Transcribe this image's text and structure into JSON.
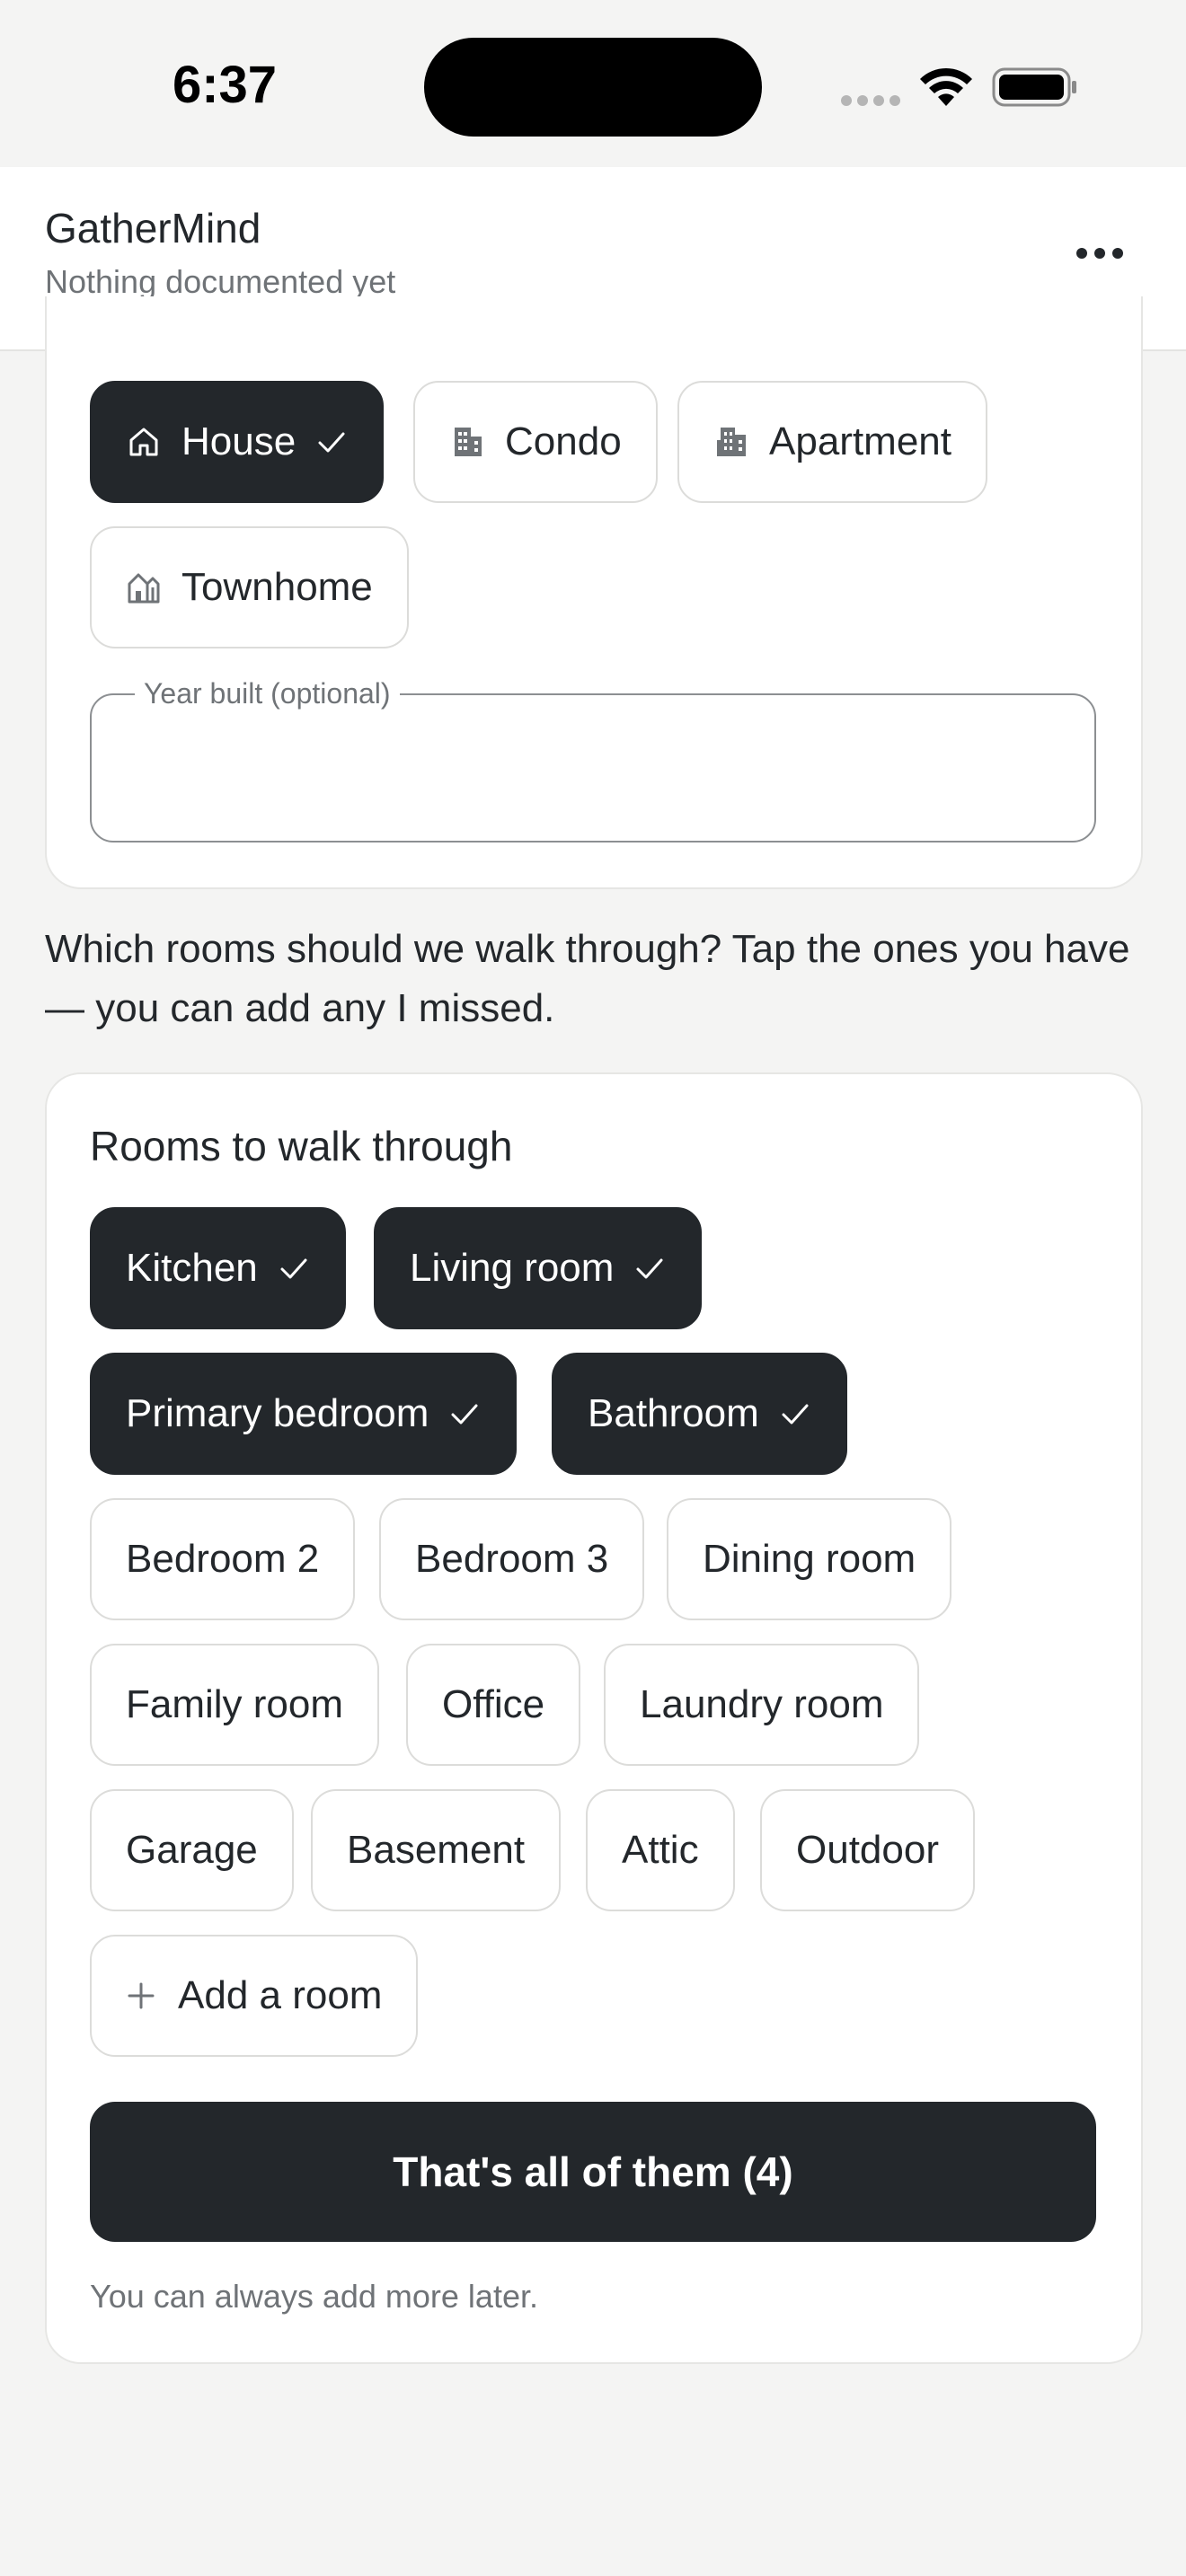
{
  "status_bar": {
    "time": "6:37"
  },
  "header": {
    "title": "GatherMind",
    "subtitle": "Nothing documented yet",
    "more_icon": "more-horizontal-icon"
  },
  "property": {
    "types": [
      {
        "label": "House",
        "icon": "home-icon",
        "selected": true
      },
      {
        "label": "Condo",
        "icon": "building-icon",
        "selected": false
      },
      {
        "label": "Apartment",
        "icon": "apartment-icon",
        "selected": false
      },
      {
        "label": "Townhome",
        "icon": "townhome-icon",
        "selected": false
      }
    ],
    "year_built_label": "Year built (optional)",
    "year_built_value": ""
  },
  "prompt": "Which rooms should we walk through? Tap the ones you have — you can add any I missed.",
  "rooms": {
    "title": "Rooms to walk through",
    "items": [
      {
        "label": "Kitchen",
        "selected": true
      },
      {
        "label": "Living room",
        "selected": true
      },
      {
        "label": "Primary bedroom",
        "selected": true
      },
      {
        "label": "Bathroom",
        "selected": true
      },
      {
        "label": "Bedroom 2",
        "selected": false
      },
      {
        "label": "Bedroom 3",
        "selected": false
      },
      {
        "label": "Dining room",
        "selected": false
      },
      {
        "label": "Family room",
        "selected": false
      },
      {
        "label": "Office",
        "selected": false
      },
      {
        "label": "Laundry room",
        "selected": false
      },
      {
        "label": "Garage",
        "selected": false
      },
      {
        "label": "Basement",
        "selected": false
      },
      {
        "label": "Attic",
        "selected": false
      },
      {
        "label": "Outdoor",
        "selected": false
      }
    ],
    "add_label": "Add a room",
    "done_label": "That's all of them (4)",
    "footnote": "You can always add more later."
  },
  "colors": {
    "accent": "#23272b",
    "background": "#f4f4f3",
    "card": "#ffffff",
    "muted": "#6f7377"
  }
}
